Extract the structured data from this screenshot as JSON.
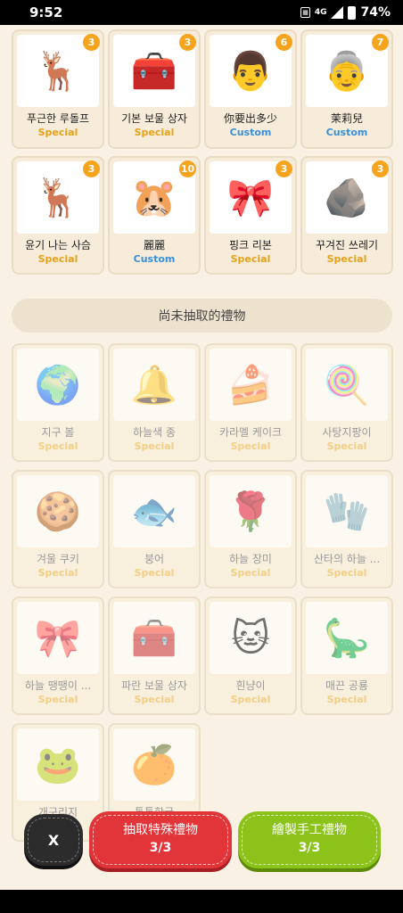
{
  "status_bar": {
    "time": "9:52",
    "network": "4G",
    "battery": "74%"
  },
  "owned_gifts": [
    {
      "name": "푸근한 루돌프",
      "type": "Special",
      "count": "3",
      "emoji": "🦌"
    },
    {
      "name": "기본 보물 상자",
      "type": "Special",
      "count": "3",
      "emoji": "🧰"
    },
    {
      "name": "你要出多少",
      "type": "Custom",
      "count": "6",
      "emoji": "👨"
    },
    {
      "name": "茉莉兒",
      "type": "Custom",
      "count": "7",
      "emoji": "👵"
    },
    {
      "name": "윤기 나는 사슴",
      "type": "Special",
      "count": "3",
      "emoji": "🦌"
    },
    {
      "name": "麗麗",
      "type": "Custom",
      "count": "10",
      "emoji": "🐹"
    },
    {
      "name": "핑크 리본",
      "type": "Special",
      "count": "3",
      "emoji": "🎀"
    },
    {
      "name": "꾸겨진 쓰레기",
      "type": "Special",
      "count": "3",
      "emoji": "🪨"
    }
  ],
  "section_title": "尚未抽取的禮物",
  "locked_gifts": [
    {
      "name": "지구 볼",
      "type": "Special",
      "emoji": "🌍"
    },
    {
      "name": "하늘색 종",
      "type": "Special",
      "emoji": "🔔"
    },
    {
      "name": "카라멜 케이크",
      "type": "Special",
      "emoji": "🍰"
    },
    {
      "name": "사탕지팡이",
      "type": "Special",
      "emoji": "🍭"
    },
    {
      "name": "겨울 쿠키",
      "type": "Special",
      "emoji": "🍪"
    },
    {
      "name": "붕어",
      "type": "Special",
      "emoji": "🐟"
    },
    {
      "name": "하늘 장미",
      "type": "Special",
      "emoji": "🌹"
    },
    {
      "name": "산타의 하늘 ...",
      "type": "Special",
      "emoji": "🧤"
    },
    {
      "name": "하늘 땡땡이 ...",
      "type": "Special",
      "emoji": "🎀"
    },
    {
      "name": "파란 보물 상자",
      "type": "Special",
      "emoji": "🧰"
    },
    {
      "name": "흰냥이",
      "type": "Special",
      "emoji": "🐱"
    },
    {
      "name": "매끈 공룡",
      "type": "Special",
      "emoji": "🦕"
    },
    {
      "name": "개구리지",
      "type": "",
      "emoji": "🐸"
    },
    {
      "name": "통통한귤",
      "type": "",
      "emoji": "🍊"
    }
  ],
  "buttons": {
    "close": "X",
    "special": {
      "label": "抽取特殊禮物",
      "count": "3/3"
    },
    "craft": {
      "label": "繪製手工禮物",
      "count": "3/3"
    }
  }
}
